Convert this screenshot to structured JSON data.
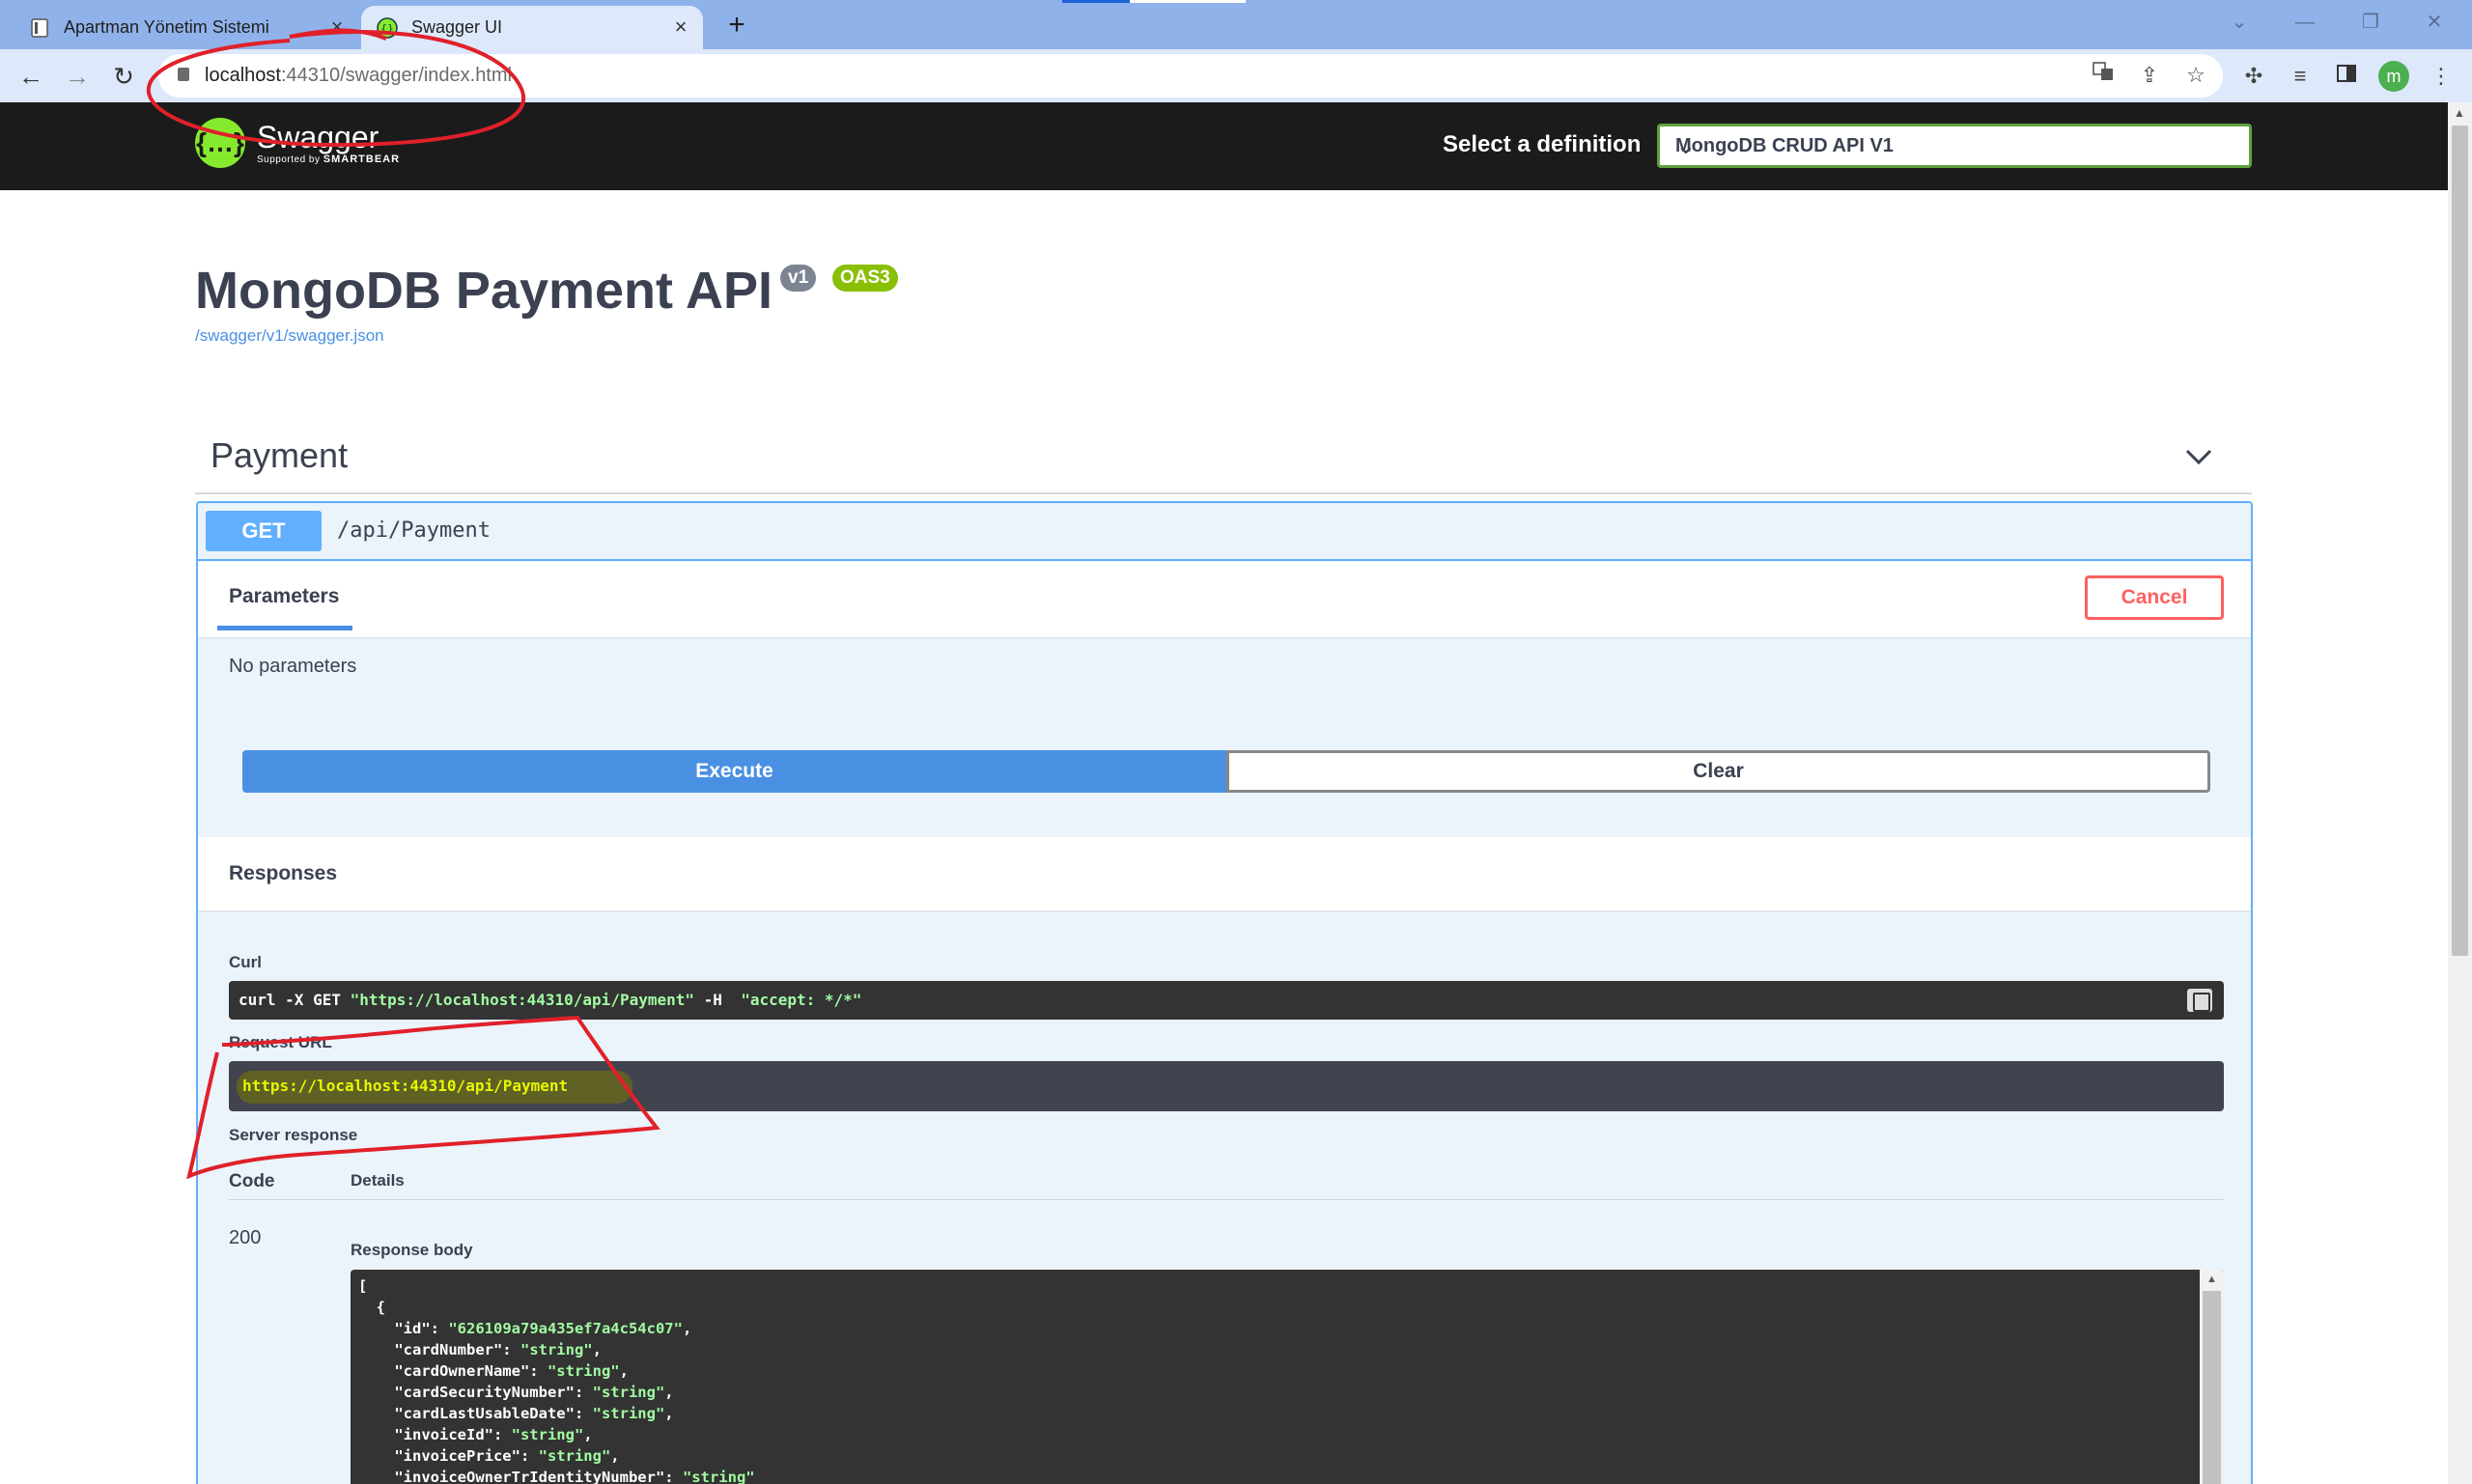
{
  "browser": {
    "tabs": [
      {
        "title": "Apartman Yönetim Sistemi",
        "active": false
      },
      {
        "title": "Swagger UI",
        "active": true
      }
    ],
    "url_host": "localhost",
    "url_rest": ":44310/swagger/index.html",
    "profile_initial": "m"
  },
  "swagger_bar": {
    "logo_name": "Swagger",
    "logo_supported": "Supported by",
    "logo_brand": "SMARTBEAR",
    "definition_label": "Select a definition",
    "definition_selected": "MongoDB CRUD API V1"
  },
  "info": {
    "title": "MongoDB Payment API",
    "version_badge": "v1",
    "oas_badge": "OAS3",
    "spec_link": "/swagger/v1/swagger.json"
  },
  "tag": {
    "name": "Payment"
  },
  "operation": {
    "method": "GET",
    "path": "/api/Payment",
    "params_tab": "Parameters",
    "cancel_label": "Cancel",
    "no_params": "No parameters",
    "execute_label": "Execute",
    "clear_label": "Clear",
    "responses_title": "Responses",
    "curl_label": "Curl",
    "curl_cmd": "curl -X GET ",
    "curl_url": "\"https://localhost:44310/api/Payment\"",
    "curl_h": " -H  ",
    "curl_accept": "\"accept: */*\"",
    "request_url_label": "Request URL",
    "request_url": "https://localhost:44310/api/Payment",
    "server_response_label": "Server response",
    "code_header": "Code",
    "details_header": "Details",
    "status_code": "200",
    "response_body_label": "Response body",
    "response_body": [
      {
        "k": "",
        "v": "["
      },
      {
        "k": "  ",
        "v": "{"
      },
      {
        "k": "    \"id\": ",
        "v": "\"626109a79a435ef7a4c54c07\"",
        "t": ","
      },
      {
        "k": "    \"cardNumber\": ",
        "v": "\"string\"",
        "t": ","
      },
      {
        "k": "    \"cardOwnerName\": ",
        "v": "\"string\"",
        "t": ","
      },
      {
        "k": "    \"cardSecurityNumber\": ",
        "v": "\"string\"",
        "t": ","
      },
      {
        "k": "    \"cardLastUsableDate\": ",
        "v": "\"string\"",
        "t": ","
      },
      {
        "k": "    \"invoiceId\": ",
        "v": "\"string\"",
        "t": ","
      },
      {
        "k": "    \"invoicePrice\": ",
        "v": "\"string\"",
        "t": ","
      },
      {
        "k": "    \"invoiceOwnerTrIdentityNumber\": ",
        "v": "\"string\"",
        "t": ""
      }
    ]
  },
  "colors": {
    "get_blue": "#61affe",
    "execute_blue": "#4990e2",
    "cancel_red": "#ff6060",
    "swagger_green": "#85ea2d",
    "annotation_red": "#e0202a"
  }
}
